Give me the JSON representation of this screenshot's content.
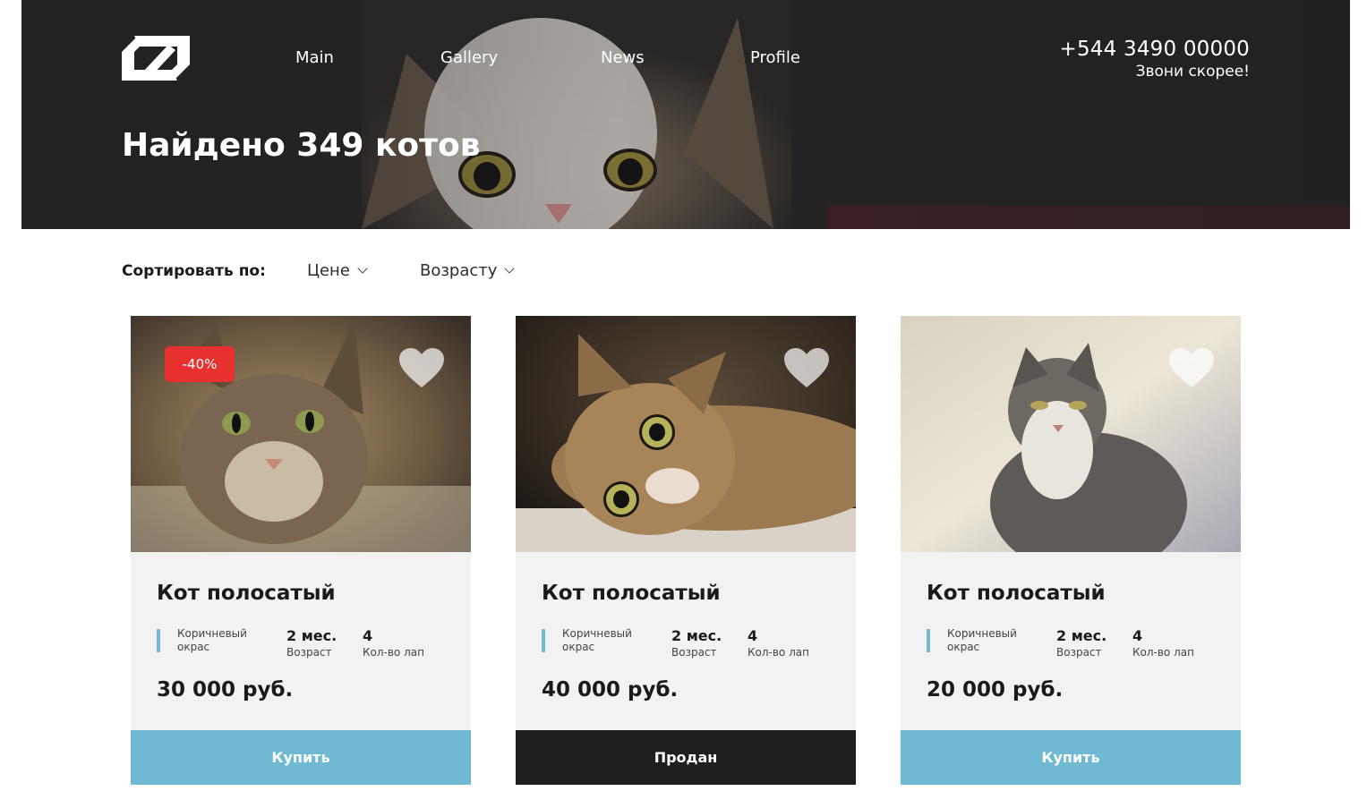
{
  "header": {
    "logo_icon": "logo-mark-icon",
    "nav": [
      {
        "label": "Main"
      },
      {
        "label": "Gallery"
      },
      {
        "label": "News"
      },
      {
        "label": "Profile"
      }
    ],
    "phone": "+544 3490 00000",
    "phone_caption": "Звони скорее!",
    "title": "Найдено 349 котов"
  },
  "sort": {
    "label": "Сортировать по:",
    "options": [
      {
        "label": "Цене",
        "icon": "chevron-down-icon"
      },
      {
        "label": "Возрасту",
        "icon": "chevron-down-icon"
      }
    ]
  },
  "cards": [
    {
      "title": "Кот полосатый",
      "discount": "-40%",
      "color": "Коричневый окрас",
      "age_value": "2 мес.",
      "age_label": "Возраст",
      "paws_value": "4",
      "paws_label": "Кол-во лап",
      "price": "30 000 руб.",
      "button": "Купить",
      "status": "available"
    },
    {
      "title": "Кот полосатый",
      "color": "Коричневый окрас",
      "age_value": "2 мес.",
      "age_label": "Возраст",
      "paws_value": "4",
      "paws_label": "Кол-во лап",
      "price": "40 000 руб.",
      "button": "Продан",
      "status": "sold"
    },
    {
      "title": "Кот полосатый",
      "color": "Коричневый окрас",
      "age_value": "2 мес.",
      "age_label": "Возраст",
      "paws_value": "4",
      "paws_label": "Кол-во лап",
      "price": "20 000 руб.",
      "button": "Купить",
      "status": "available"
    }
  ],
  "colors": {
    "accent": "#6fb9d3",
    "sold": "#1e1f21",
    "discount": "#e8302f",
    "card_bg": "#f2f2f2"
  }
}
